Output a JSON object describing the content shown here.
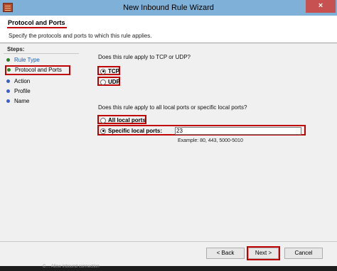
{
  "window": {
    "title": "New Inbound Rule Wizard",
    "close_label": "×"
  },
  "header": {
    "title": "Protocol and Ports",
    "subtitle": "Specify the protocols and ports to which this rule applies."
  },
  "steps": {
    "label": "Steps:",
    "items": [
      {
        "label": "Rule Type",
        "state": "done"
      },
      {
        "label": "Protocol and Ports",
        "state": "current"
      },
      {
        "label": "Action",
        "state": "pending"
      },
      {
        "label": "Profile",
        "state": "pending"
      },
      {
        "label": "Name",
        "state": "pending"
      }
    ]
  },
  "protocol": {
    "question": "Does this rule apply to TCP or UDP?",
    "options": [
      {
        "label": "TCP",
        "selected": true
      },
      {
        "label": "UDP",
        "selected": false
      }
    ]
  },
  "ports": {
    "question": "Does this rule apply to all local ports or specific local ports?",
    "all_label": "All local ports",
    "specific_label": "Specific local ports:",
    "specific_selected": true,
    "value": "23",
    "example": "Example: 80, 443, 5000-5010"
  },
  "buttons": {
    "back": "< Back",
    "next": "Next >",
    "cancel": "Cancel"
  },
  "taskbar": {
    "text": "C…  Allow inbound connection"
  },
  "colors": {
    "highlight": "#c00000",
    "titlebar": "#7fb0d8",
    "close": "#c75050",
    "link": "#1a5fb4"
  },
  "icons": [
    "firewall-wizard-icon",
    "close-icon"
  ]
}
